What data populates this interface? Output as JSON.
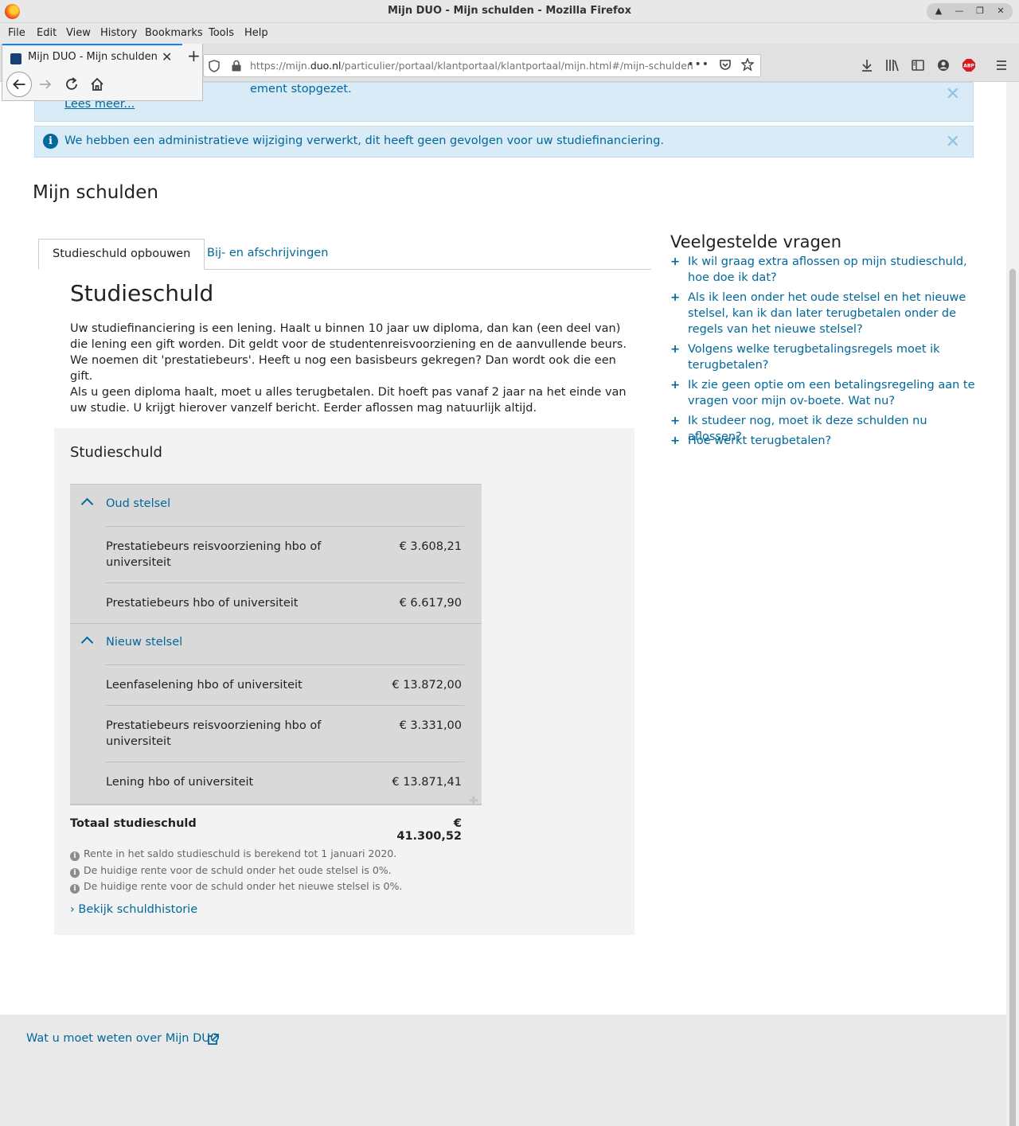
{
  "window": {
    "title": "Mijn DUO - Mijn schulden - Mozilla Firefox"
  },
  "menu": [
    "File",
    "Edit",
    "View",
    "History",
    "Bookmarks",
    "Tools",
    "Help"
  ],
  "tab": {
    "title": "Mijn DUO - Mijn schulden"
  },
  "url": {
    "prefix": "https://mijn.",
    "domain": "duo.nl",
    "path": "/particulier/portaal/klantportaal/klantportaal/mijn.html#/mijn-schulden"
  },
  "alerts": [
    {
      "text": "ement stopgezet.",
      "link": "Lees meer..."
    },
    {
      "text": "We hebben een administratieve wijziging verwerkt, dit heeft geen gevolgen voor uw studiefinanciering."
    }
  ],
  "page": {
    "title": "Mijn schulden",
    "tabs": [
      "Studieschuld opbouwen",
      "Bij- en afschrijvingen"
    ],
    "heading": "Studieschuld",
    "paragraphs": [
      "Uw studiefinanciering is een lening. Haalt u binnen 10 jaar uw diploma, dan kan (een deel van) die lening een gift worden. Dit geldt voor de studentenreisvoorziening en de aanvullende beurs. We noemen dit 'prestatiebeurs'. Heeft u nog een basisbeurs gekregen? Dan wordt ook die een gift.",
      "Als u geen diploma haalt, moet u alles terugbetalen. Dit hoeft pas vanaf 2 jaar na het einde van uw studie. U krijgt hierover vanzelf bericht. Eerder aflossen mag natuurlijk altijd."
    ]
  },
  "debt": {
    "title": "Studieschuld",
    "groups": [
      {
        "label": "Oud stelsel",
        "rows": [
          {
            "label": "Prestatiebeurs reisvoorziening hbo of universiteit",
            "value": "€ 3.608,21"
          },
          {
            "label": "Prestatiebeurs hbo of universiteit",
            "value": "€ 6.617,90"
          }
        ]
      },
      {
        "label": "Nieuw stelsel",
        "rows": [
          {
            "label": "Leenfaselening hbo of universiteit",
            "value": "€ 13.872,00"
          },
          {
            "label": "Prestatiebeurs reisvoorziening hbo of universiteit",
            "value": "€ 3.331,00"
          },
          {
            "label": "Lening hbo of universiteit",
            "value": "€ 13.871,41"
          }
        ]
      }
    ],
    "total_label": "Totaal studieschuld",
    "total_value": "€ 41.300,52",
    "notes": [
      "Rente in het saldo studieschuld is berekend tot 1 januari 2020.",
      "De huidige rente voor de schuld onder het oude stelsel is 0%.",
      "De huidige rente voor de schuld onder het nieuwe stelsel is 0%."
    ],
    "history_link": "Bekijk schuldhistorie"
  },
  "faq": {
    "title": "Veelgestelde vragen",
    "items": [
      "Ik wil graag extra aflossen op mijn studieschuld, hoe doe ik dat?",
      "Als ik leen onder het oude stelsel en het nieuwe stelsel, kan ik dan later terugbetalen onder de regels van het nieuwe stelsel?",
      "Volgens welke terugbetalingsregels moet ik terugbetalen?",
      "Ik zie geen optie om een betalingsregeling aan te vragen voor mijn ov-boete. Wat nu?",
      "Ik studeer nog, moet ik deze schulden nu aflossen?",
      "Hoe werkt terugbetalen?"
    ]
  },
  "footer": {
    "link": "Wat u moet weten over Mijn DUO"
  },
  "colors": {
    "link": "#01689b",
    "alert_bg": "#d9ebf7",
    "panel_bg": "#f3f3f3",
    "debt_box_bg": "#d9d9d9",
    "footer_bg": "#e9e9e9"
  }
}
